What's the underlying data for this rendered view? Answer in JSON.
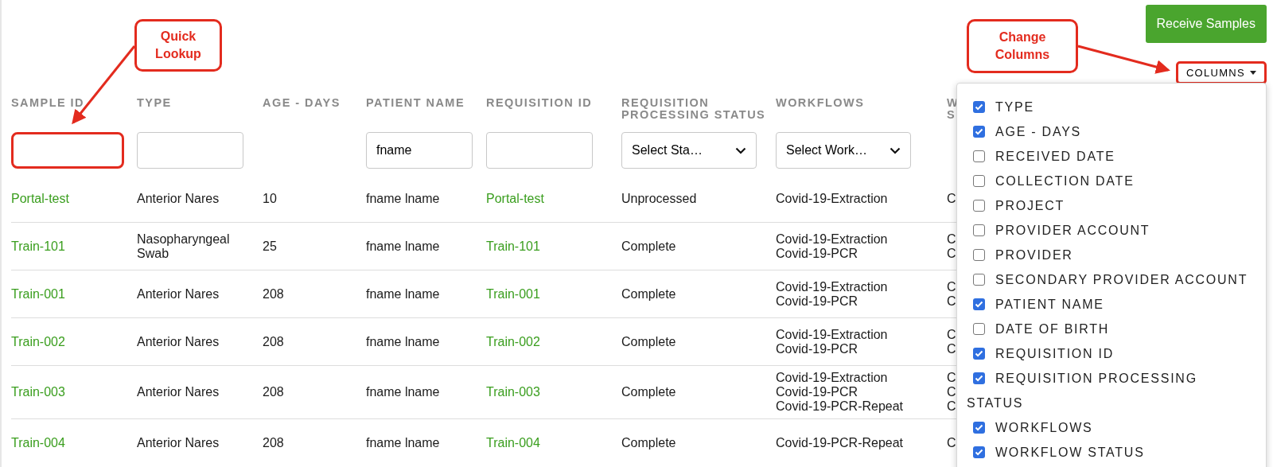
{
  "toolbar": {
    "receive_button": "Receive Samples",
    "columns_button": {
      "label": "COLUMNS",
      "highlighted": true
    }
  },
  "table": {
    "columns": [
      {
        "label": "SAMPLE ID",
        "filter": {
          "kind": "text",
          "highlighted": true
        }
      },
      {
        "label": "TYPE",
        "filter": {
          "kind": "text"
        }
      },
      {
        "label": "AGE - DAYS",
        "filter": {
          "kind": "none"
        }
      },
      {
        "label": "PATIENT NAME",
        "filter": {
          "kind": "text",
          "value": "fname"
        }
      },
      {
        "label": "REQUISITION ID",
        "filter": {
          "kind": "text"
        }
      },
      {
        "label": "REQUISITION PROCESSING STATUS",
        "filter": {
          "kind": "select",
          "placeholder": "Select Sta…"
        }
      },
      {
        "label": "WORKFLOWS",
        "filter": {
          "kind": "select",
          "placeholder": "Select Work…"
        }
      },
      {
        "label": "W S",
        "filter": {
          "kind": "none"
        }
      }
    ],
    "rows": [
      {
        "sample_id": "Portal-test",
        "type": "Anterior Nares",
        "age": "10",
        "patient_name": "fname lname",
        "requisition_id": "Portal-test",
        "status": "Unprocessed",
        "workflows": [
          "Covid-19-Extraction"
        ],
        "column_8": [
          "C"
        ]
      },
      {
        "sample_id": "Train-101",
        "type": "Nasopharyngeal Swab",
        "age": "25",
        "patient_name": "fname lname",
        "requisition_id": "Train-101",
        "status": "Complete",
        "workflows": [
          "Covid-19-Extraction",
          "Covid-19-PCR"
        ],
        "column_8": [
          "C",
          "C"
        ]
      },
      {
        "sample_id": "Train-001",
        "type": "Anterior Nares",
        "age": "208",
        "patient_name": "fname lname",
        "requisition_id": "Train-001",
        "status": "Complete",
        "workflows": [
          "Covid-19-Extraction",
          "Covid-19-PCR"
        ],
        "column_8": [
          "C",
          "C"
        ]
      },
      {
        "sample_id": "Train-002",
        "type": "Anterior Nares",
        "age": "208",
        "patient_name": "fname lname",
        "requisition_id": "Train-002",
        "status": "Complete",
        "workflows": [
          "Covid-19-Extraction",
          "Covid-19-PCR"
        ],
        "column_8": [
          "C",
          "C"
        ]
      },
      {
        "sample_id": "Train-003",
        "type": "Anterior Nares",
        "age": "208",
        "patient_name": "fname lname",
        "requisition_id": "Train-003",
        "status": "Complete",
        "workflows": [
          "Covid-19-Extraction",
          "Covid-19-PCR",
          "Covid-19-PCR-Repeat"
        ],
        "column_8": [
          "C",
          "C",
          "C"
        ]
      },
      {
        "sample_id": "Train-004",
        "type": "Anterior Nares",
        "age": "208",
        "patient_name": "fname lname",
        "requisition_id": "Train-004",
        "status": "Complete",
        "workflows": [
          "Covid-19-PCR-Repeat"
        ],
        "column_8": [
          "C"
        ]
      }
    ]
  },
  "columns_menu": [
    {
      "label": "TYPE",
      "checked": true
    },
    {
      "label": "AGE - DAYS",
      "checked": true
    },
    {
      "label": "RECEIVED DATE",
      "checked": false
    },
    {
      "label": "COLLECTION DATE",
      "checked": false
    },
    {
      "label": "PROJECT",
      "checked": false
    },
    {
      "label": "PROVIDER ACCOUNT",
      "checked": false
    },
    {
      "label": "PROVIDER",
      "checked": false
    },
    {
      "label": "SECONDARY PROVIDER ACCOUNT",
      "checked": false
    },
    {
      "label": "PATIENT NAME",
      "checked": true
    },
    {
      "label": "DATE OF BIRTH",
      "checked": false
    },
    {
      "label": "REQUISITION ID",
      "checked": true
    },
    {
      "label": "REQUISITION PROCESSING STATUS",
      "checked": true
    },
    {
      "label": "WORKFLOWS",
      "checked": true
    },
    {
      "label": "WORKFLOW STATUS",
      "checked": true
    }
  ],
  "annotations": [
    {
      "text": "Quick Lookup"
    },
    {
      "text": "Change Columns"
    }
  ]
}
